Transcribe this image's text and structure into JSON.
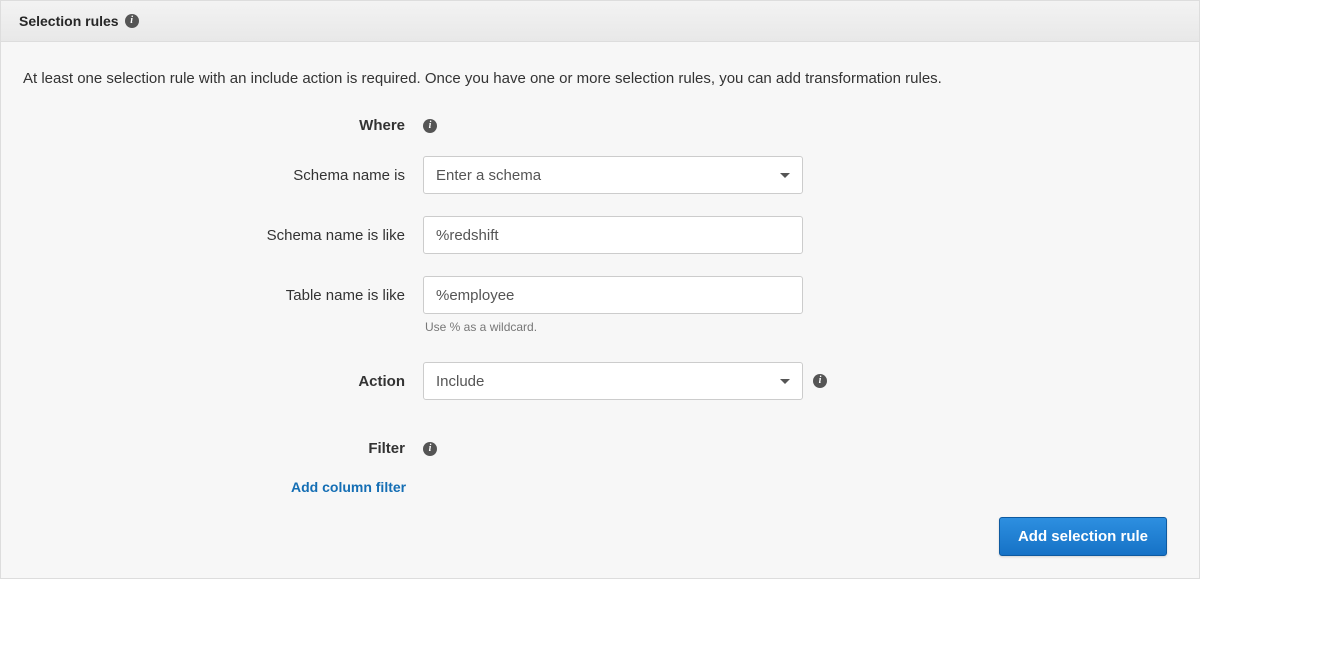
{
  "header": {
    "title": "Selection rules"
  },
  "description": "At least one selection rule with an include action is required. Once you have one or more selection rules, you can add transformation rules.",
  "labels": {
    "where": "Where",
    "schema_name_is": "Schema name is",
    "schema_name_is_like": "Schema name is like",
    "table_name_is_like": "Table name is like",
    "action": "Action",
    "filter": "Filter"
  },
  "fields": {
    "schema_dropdown": {
      "selected": "Enter a schema"
    },
    "schema_like": {
      "value": "%redshift"
    },
    "table_like": {
      "value": "%employee"
    },
    "wildcard_hint": "Use % as a wildcard.",
    "action_dropdown": {
      "selected": "Include"
    }
  },
  "links": {
    "add_column_filter": "Add column filter"
  },
  "buttons": {
    "add_rule": "Add selection rule"
  }
}
